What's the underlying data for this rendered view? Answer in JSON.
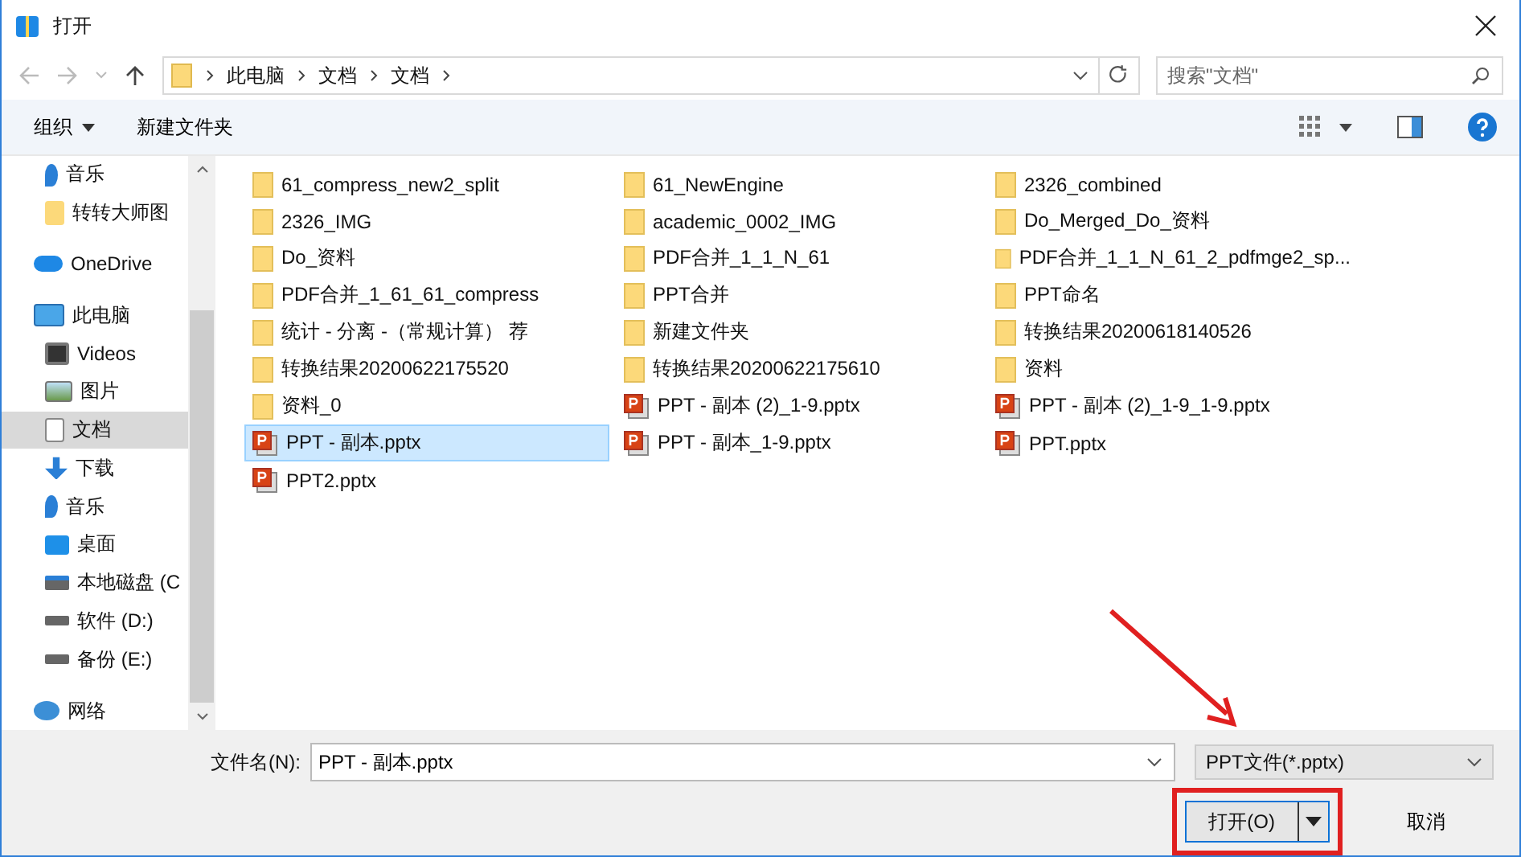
{
  "window": {
    "title": "打开"
  },
  "address": {
    "path": [
      "此电脑",
      "文档",
      "文档"
    ],
    "search_placeholder": "搜索\"文档\""
  },
  "toolbar": {
    "organize": "组织",
    "new_folder": "新建文件夹"
  },
  "sidebar": {
    "quick_access": [
      {
        "label": "音乐",
        "kind": "music",
        "selected": false
      },
      {
        "label": "转转大师图",
        "kind": "folder",
        "selected": false
      }
    ],
    "items": [
      {
        "label": "OneDrive",
        "kind": "cloud",
        "selected": false
      },
      {
        "label": "此电脑",
        "kind": "pc",
        "selected": false,
        "children": [
          {
            "label": "Videos",
            "kind": "video",
            "selected": false
          },
          {
            "label": "图片",
            "kind": "picture",
            "selected": false
          },
          {
            "label": "文档",
            "kind": "doc",
            "selected": true
          },
          {
            "label": "下载",
            "kind": "download",
            "selected": false
          },
          {
            "label": "音乐",
            "kind": "music",
            "selected": false
          },
          {
            "label": "桌面",
            "kind": "desktop",
            "selected": false
          },
          {
            "label": "本地磁盘 (C",
            "kind": "system-drive",
            "selected": false
          },
          {
            "label": "软件 (D:)",
            "kind": "drive",
            "selected": false
          },
          {
            "label": "备份 (E:)",
            "kind": "drive",
            "selected": false
          }
        ]
      },
      {
        "label": "网络",
        "kind": "network",
        "selected": false
      }
    ]
  },
  "file_columns": [
    [
      {
        "name": "61_compress_new2_split",
        "kind": "folder",
        "selected": false
      },
      {
        "name": "2326_IMG",
        "kind": "folder",
        "selected": false
      },
      {
        "name": "Do_资料",
        "kind": "folder",
        "selected": false
      },
      {
        "name": "PDF合并_1_61_61_compress",
        "kind": "folder",
        "selected": false
      },
      {
        "name": "统计 - 分离 -（常规计算） 荐",
        "kind": "folder",
        "selected": false
      },
      {
        "name": "转换结果20200622175520",
        "kind": "folder",
        "selected": false
      },
      {
        "name": "资料_0",
        "kind": "folder",
        "selected": false
      },
      {
        "name": "PPT - 副本.pptx",
        "kind": "pptx",
        "selected": true
      },
      {
        "name": "PPT2.pptx",
        "kind": "pptx",
        "selected": false
      }
    ],
    [
      {
        "name": "61_NewEngine",
        "kind": "folder",
        "selected": false
      },
      {
        "name": "academic_0002_IMG",
        "kind": "folder",
        "selected": false
      },
      {
        "name": "PDF合并_1_1_N_61",
        "kind": "folder",
        "selected": false
      },
      {
        "name": "PPT合并",
        "kind": "folder",
        "selected": false
      },
      {
        "name": "新建文件夹",
        "kind": "folder",
        "selected": false
      },
      {
        "name": "转换结果20200622175610",
        "kind": "folder",
        "selected": false
      },
      {
        "name": "PPT - 副本 (2)_1-9.pptx",
        "kind": "pptx",
        "selected": false
      },
      {
        "name": "PPT - 副本_1-9.pptx",
        "kind": "pptx",
        "selected": false
      }
    ],
    [
      {
        "name": "2326_combined",
        "kind": "folder",
        "selected": false
      },
      {
        "name": "Do_Merged_Do_资料",
        "kind": "folder",
        "selected": false
      },
      {
        "name": "PDF合并_1_1_N_61_2_pdfmge2_sp...",
        "kind": "folder",
        "selected": false
      },
      {
        "name": "PPT命名",
        "kind": "folder",
        "selected": false
      },
      {
        "name": "转换结果20200618140526",
        "kind": "folder",
        "selected": false
      },
      {
        "name": "资料",
        "kind": "folder",
        "selected": false
      },
      {
        "name": "PPT - 副本 (2)_1-9_1-9.pptx",
        "kind": "pptx",
        "selected": false
      },
      {
        "name": "PPT.pptx",
        "kind": "pptx",
        "selected": false
      }
    ]
  ],
  "footer": {
    "filename_label": "文件名(N):",
    "filename": "PPT - 副本.pptx",
    "filter": "PPT文件(*.pptx)",
    "open": "打开(O)",
    "cancel": "取消"
  },
  "annotation": {
    "highlight": true,
    "arrow": true
  }
}
